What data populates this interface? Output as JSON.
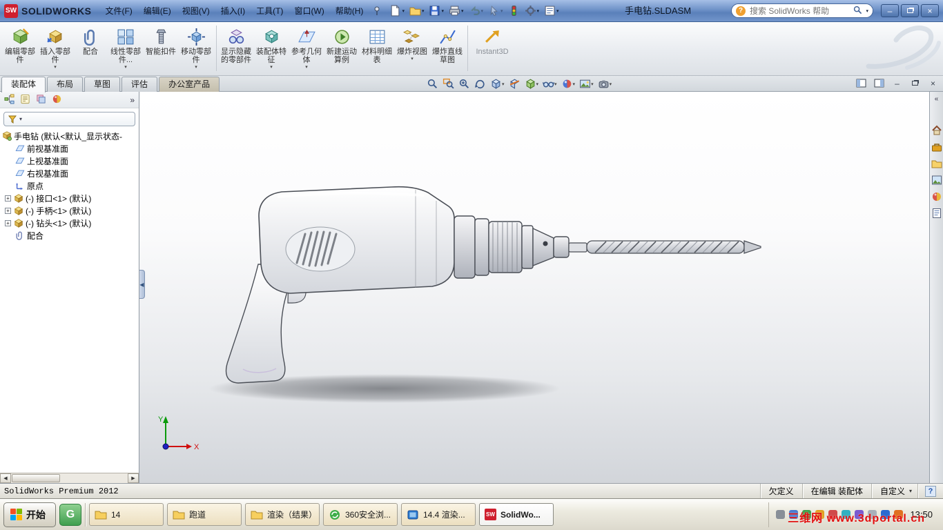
{
  "icons": {
    "caret_down": "▾",
    "chevron_right": "»",
    "chevron_left": "«",
    "close": "×",
    "minimize": "–",
    "plus": "+",
    "scroll_left": "◀",
    "scroll_right": "▶",
    "help": "?",
    "sw_mark": "SW",
    "g_mark": "G",
    "icon_names": {
      "quick_access": [
        "new-document-icon",
        "open-icon",
        "save-icon",
        "print-icon",
        "undo-icon",
        "select-icon",
        "rebuild-icon",
        "options-icon",
        "file-properties-icon"
      ],
      "heads_up": [
        "zoom-fit-icon",
        "zoom-area-icon",
        "zoom-in-out-icon",
        "rotate-view-icon",
        "view-orientation-icon",
        "section-view-icon",
        "display-style-icon",
        "hide-show-items-icon",
        "edit-appearance-icon",
        "apply-scene-icon",
        "view-settings-icon"
      ],
      "task_pane": [
        "resources-icon",
        "toolbox-icon",
        "file-explorer-icon",
        "view-palette-icon",
        "appearances-icon",
        "custom-properties-icon"
      ]
    }
  },
  "titlebar": {
    "app_name": "SOLIDWORKS",
    "menus": [
      "文件(F)",
      "编辑(E)",
      "视图(V)",
      "插入(I)",
      "工具(T)",
      "窗口(W)",
      "帮助(H)"
    ],
    "document_title": "手电钻.SLDASM",
    "search_placeholder": "搜索 SolidWorks 帮助"
  },
  "ribbon": {
    "buttons": [
      {
        "label": "编辑零部件",
        "arrow": false
      },
      {
        "label": "插入零部件",
        "arrow": true
      },
      {
        "label": "配合",
        "arrow": false
      },
      {
        "label": "线性零部件...",
        "arrow": true
      },
      {
        "label": "智能扣件",
        "arrow": false
      },
      {
        "label": "移动零部件",
        "arrow": true
      },
      {
        "label": "显示隐藏的零部件",
        "arrow": false
      },
      {
        "label": "装配体特征",
        "arrow": true
      },
      {
        "label": "参考几何体",
        "arrow": true
      },
      {
        "label": "新建运动算例",
        "arrow": false
      },
      {
        "label": "材料明细表",
        "arrow": false
      },
      {
        "label": "爆炸视图",
        "arrow": true
      },
      {
        "label": "爆炸直线草图",
        "arrow": false
      },
      {
        "label": "Instant3D",
        "arrow": false
      }
    ]
  },
  "tabs": {
    "items": [
      "装配体",
      "布局",
      "草图",
      "评估",
      "办公室产品"
    ],
    "active": "装配体"
  },
  "feature_tree": {
    "root": "手电钻 (默认<默认_显示状态-",
    "items": [
      {
        "label": "前视基准面",
        "icon": "plane-icon",
        "expandable": false
      },
      {
        "label": "上视基准面",
        "icon": "plane-icon",
        "expandable": false
      },
      {
        "label": "右视基准面",
        "icon": "plane-icon",
        "expandable": false
      },
      {
        "label": "原点",
        "icon": "origin-icon",
        "expandable": false
      },
      {
        "label": "(-) 接口<1> (默认)",
        "icon": "part-icon",
        "expandable": true
      },
      {
        "label": "(-) 手柄<1> (默认)",
        "icon": "part-icon",
        "expandable": true
      },
      {
        "label": "(-) 钻头<1> (默认)",
        "icon": "part-icon",
        "expandable": true
      },
      {
        "label": "配合",
        "icon": "mates-icon",
        "expandable": false
      }
    ]
  },
  "triad": {
    "x": "X",
    "y": "Y"
  },
  "statusbar": {
    "left": "SolidWorks Premium 2012",
    "defined": "欠定义",
    "editing": "在编辑 装配体",
    "custom": "自定义"
  },
  "taskbar": {
    "start": "开始",
    "tasks": [
      {
        "label": "14",
        "icon": "folder-icon"
      },
      {
        "label": "跑道",
        "icon": "folder-icon"
      },
      {
        "label": "渲染（结果）",
        "icon": "folder-icon"
      },
      {
        "label": "360安全浏...",
        "icon": "browser-360-icon"
      },
      {
        "label": "14.4 渲染...",
        "icon": "render-app-icon"
      },
      {
        "label": "SolidWo...",
        "icon": "solidworks-icon",
        "active": true
      }
    ],
    "time": "13:50",
    "watermark": "三维网 www.3dportal.cn"
  },
  "colors": {
    "titlebar_blue": "#5a80ba",
    "sw_red": "#cf1f2e",
    "watermark_red": "#e21010",
    "viewport_top": "#ffffff",
    "viewport_bottom": "#d2d5da"
  }
}
